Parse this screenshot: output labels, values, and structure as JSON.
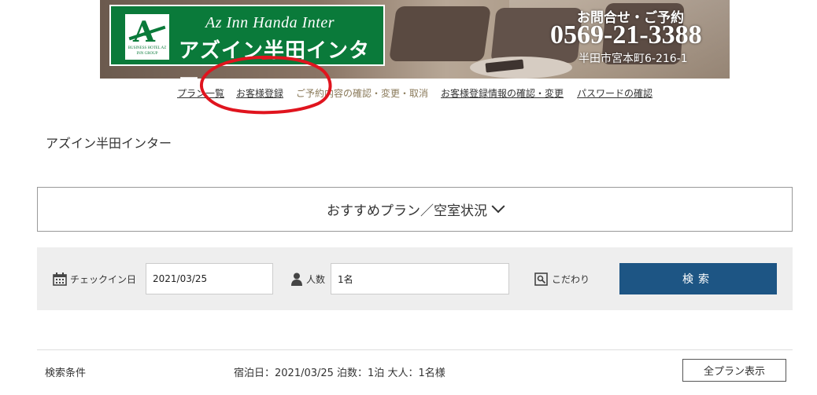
{
  "banner": {
    "logo_en": "Az Inn Handa Inter",
    "logo_jp": "アズイン半田インター",
    "logo_mark_letter": "A",
    "logo_mark_sub": "BUSINESS HOTEL AZ INN GROUP",
    "contact_label": "お問合せ・ご予約",
    "phone": "0569-21-3388",
    "address": "半田市宮本町6-216-1"
  },
  "nav": {
    "items": [
      {
        "label": "プラン一覧"
      },
      {
        "label": "お客様登録"
      },
      {
        "label": "ご予約内容の確認・変更・取消"
      },
      {
        "label": "お客様登録情報の確認・変更"
      },
      {
        "label": "パスワードの確認"
      }
    ]
  },
  "hotel_name": "アズイン半田インター",
  "plans_toggle": {
    "label": "おすすめプラン／空室状況"
  },
  "search": {
    "checkin_label": "チェックイン日",
    "checkin_value": "2021/03/25",
    "people_label": "人数",
    "people_value": "1名",
    "filter_label": "こだわり",
    "button_label": "検索"
  },
  "conditions": {
    "label": "検索条件",
    "value": "宿泊日：2021/03/25 泊数：1泊 大人：1名様",
    "all_plans_button": "全プラン表示"
  },
  "colors": {
    "brand_green": "#0a7a3a",
    "search_button": "#1d5584",
    "annotation_red": "#e0141e"
  },
  "icons": {
    "calendar": "calendar-icon",
    "person": "person-icon",
    "filter": "search-filter-icon",
    "chevron": "chevron-down-icon"
  }
}
